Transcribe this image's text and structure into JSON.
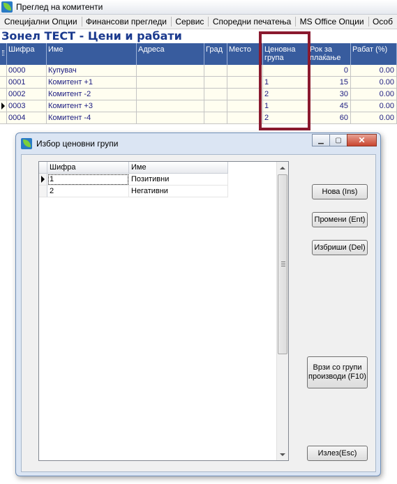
{
  "main_window": {
    "title": "Преглед на комитенти",
    "menu": [
      "Специјални Опции",
      "Финансови прегледи",
      "Сервис",
      "Споредни печатења",
      "MS Office Опции",
      "Особ"
    ]
  },
  "report": {
    "title": "Зонел ТЕСТ - Цени и рабати"
  },
  "grid": {
    "columns": {
      "sifra": "Шифра",
      "ime": "Име",
      "adresa": "Адреса",
      "grad": "Град",
      "mesto": "Место",
      "cenovna": "Ценовна група",
      "rok": "Рок за плаќање",
      "rabat": "Рабат (%)"
    },
    "rows": [
      {
        "sifra": "0000",
        "ime": "Купувач",
        "adresa": "",
        "grad": "",
        "mesto": "",
        "cenovna": "",
        "rok": "0",
        "rabat": "0.00"
      },
      {
        "sifra": "0001",
        "ime": "Комитент  +1",
        "adresa": "",
        "grad": "",
        "mesto": "",
        "cenovna": "1",
        "rok": "15",
        "rabat": "0.00"
      },
      {
        "sifra": "0002",
        "ime": "Комитент  -2",
        "adresa": "",
        "grad": "",
        "mesto": "",
        "cenovna": "2",
        "rok": "30",
        "rabat": "0.00"
      },
      {
        "sifra": "0003",
        "ime": "Комитент  +3",
        "adresa": "",
        "grad": "",
        "mesto": "",
        "cenovna": "1",
        "rok": "45",
        "rabat": "0.00"
      },
      {
        "sifra": "0004",
        "ime": "Комитент  -4",
        "adresa": "",
        "grad": "",
        "mesto": "",
        "cenovna": "2",
        "rok": "60",
        "rabat": "0.00"
      }
    ],
    "current_row_index": 3,
    "highlight_color": "#8a1a2f",
    "header_color": "#385c9e"
  },
  "dialog": {
    "title": "Избор ценовни групи",
    "grid": {
      "columns": {
        "sifra": "Шифра",
        "ime": "Име"
      },
      "rows": [
        {
          "sifra": "1",
          "ime": "Позитивни"
        },
        {
          "sifra": "2",
          "ime": "Негативни"
        }
      ]
    },
    "buttons": {
      "nova": "Нова (Ins)",
      "promeni": "Промени (Ent)",
      "izbrisi": "Избриши (Del)",
      "vrzi": "Врзи со групи производи (F10)",
      "izlez": "Излез(Esc)"
    }
  }
}
